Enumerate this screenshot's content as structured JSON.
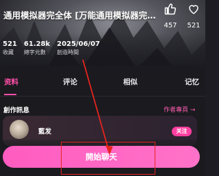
{
  "header": {
    "title": "通用模拟器完全体 [万能通用模拟器完…",
    "actions": [
      {
        "icon": "thumbs-up-icon",
        "count": "457"
      },
      {
        "icon": "heart-icon",
        "count": "521"
      }
    ]
  },
  "stats": [
    {
      "value": "521",
      "label": "收藏"
    },
    {
      "value": "61.28k",
      "label": "總字元數"
    },
    {
      "value": "2025/06/07",
      "label": "創造時間"
    }
  ],
  "tabs": [
    {
      "label": "资料",
      "active": true
    },
    {
      "label": "评论",
      "active": false
    },
    {
      "label": "相似",
      "active": false
    },
    {
      "label": "记忆",
      "active": false
    }
  ],
  "creator": {
    "section_title": "創作訊息",
    "author_link": "作者專頁 →",
    "name": "藍发",
    "follow_label": "关注"
  },
  "cta": {
    "label": "開始聊天"
  },
  "colors": {
    "accent": "#ff4fa8",
    "button": "#ff5cc0",
    "annotation": "#e6251e"
  }
}
